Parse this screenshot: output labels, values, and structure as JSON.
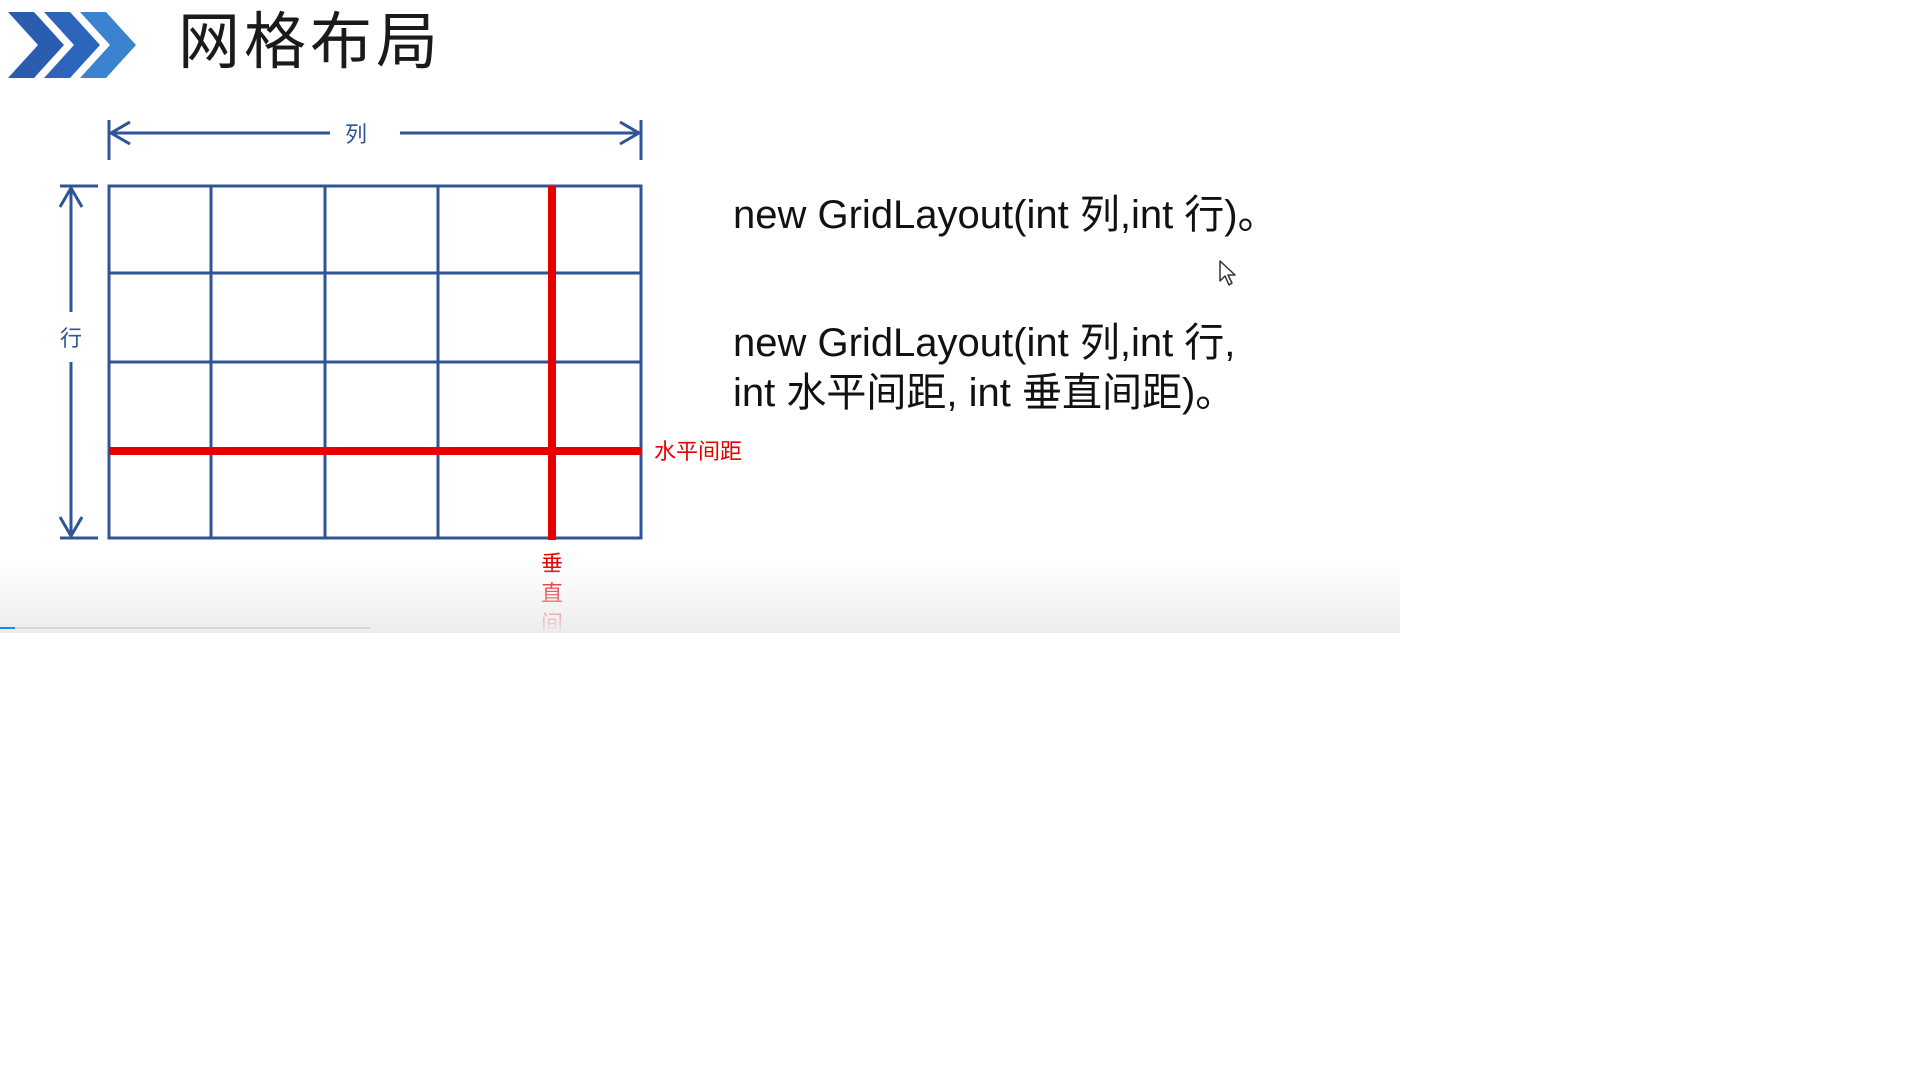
{
  "slide": {
    "title": "网格布局",
    "icon": "triple-chevron-right-icon",
    "colors": {
      "chevron_dark": "#1f4e9e",
      "chevron_light": "#3f86d4",
      "grid_line": "#2f5597",
      "highlight": "#e60000",
      "text": "#111111"
    }
  },
  "diagram": {
    "column_label": "列",
    "row_label": "行",
    "horizontal_gap_label": "水平间距",
    "vertical_gap_chars": [
      "垂",
      "直",
      "间"
    ],
    "grid": {
      "columns": 5,
      "rows": 4
    }
  },
  "code": {
    "line1": "new GridLayout(int 列,int 行)。",
    "line2a": "new GridLayout(int 列,int 行,",
    "line2b": "int 水平间距, int 垂直间距)。"
  },
  "player": {
    "progress_fraction": 0.04
  }
}
